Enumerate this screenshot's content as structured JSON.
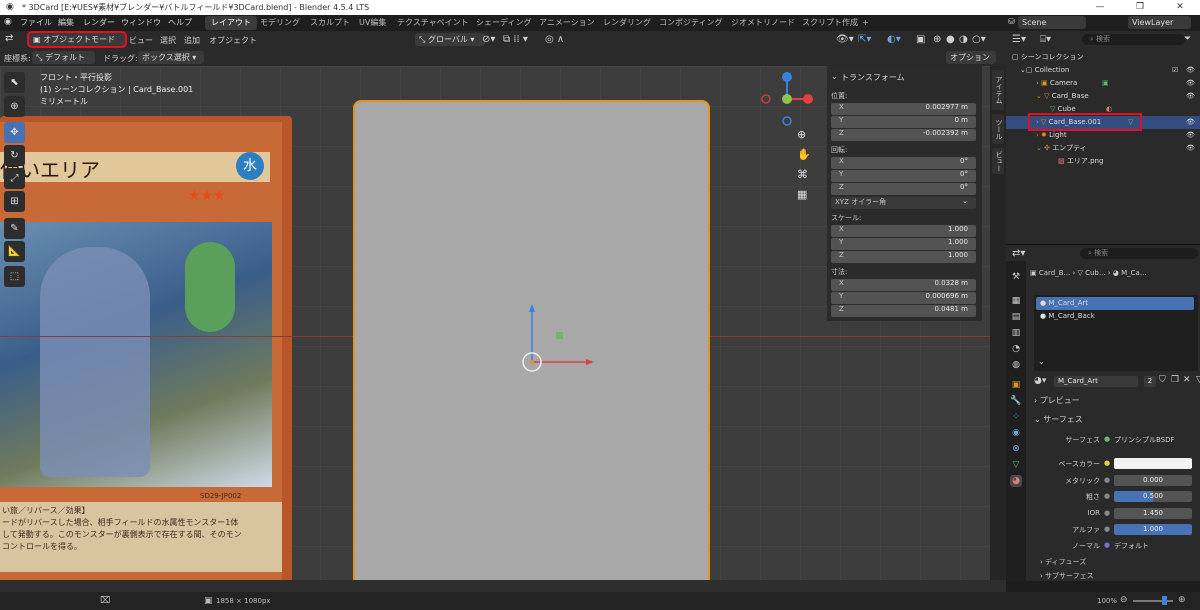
{
  "window": {
    "title": "* 3DCard [E:¥UES¥素材¥ブレンダー¥バトルフィールド¥3DCard.blend] - Blender 4.5.4 LTS",
    "min": "—",
    "max": "❐",
    "close": "✕"
  },
  "menu": [
    "ファイル",
    "編集",
    "レンダー",
    "ウィンドウ",
    "ヘルプ"
  ],
  "tabs": [
    {
      "label": "レイアウト"
    },
    {
      "label": "モデリング"
    },
    {
      "label": "スカルプト"
    },
    {
      "label": "UV編集"
    },
    {
      "label": "テクスチャペイント"
    },
    {
      "label": "シェーディング"
    },
    {
      "label": "アニメーション"
    },
    {
      "label": "レンダリング"
    },
    {
      "label": "コンポジティング"
    },
    {
      "label": "ジオメトリノード"
    },
    {
      "label": "スクリプト作成"
    }
  ],
  "add_tab": "+",
  "scene": "Scene",
  "viewlayer": "ViewLayer",
  "header": {
    "mode": "オブジェクトモード",
    "view": "ビュー",
    "select": "選択",
    "add": "追加",
    "object": "オブジェクト",
    "orientation": "グローバル"
  },
  "header2": {
    "coord_label": "座標系:",
    "coord": "デフォルト",
    "drag_label": "ドラッグ:",
    "drag": "ボックス選択",
    "options": "オプション"
  },
  "overlay": {
    "line1": "フロント・平行投影",
    "line2": "(1) シーンコレクション | Card_Base.001",
    "line3": "ミリメートル"
  },
  "card": {
    "title": "使いエリア",
    "attr": "水",
    "code": "SD29-JP002",
    "text1": "い旅／リバース／効果】",
    "text2": "ードがリバースした場合、相手フィールドの水属性モンスター1体",
    "text3": "して発動する。このモンスターが裏側表示で存在する間、そのモン",
    "text4": "コントロールを得る。"
  },
  "transform": {
    "title": "トランスフォーム",
    "location_label": "位置:",
    "location": [
      {
        "axis": "X",
        "value": "0.002977 m"
      },
      {
        "axis": "Y",
        "value": "0 m"
      },
      {
        "axis": "Z",
        "value": "-0.002392 m"
      }
    ],
    "rotation_label": "回転:",
    "rotation": [
      {
        "axis": "X",
        "value": "0°"
      },
      {
        "axis": "Y",
        "value": "0°"
      },
      {
        "axis": "Z",
        "value": "0°"
      }
    ],
    "rotation_mode": "XYZ オイラー角",
    "scale_label": "スケール:",
    "scale": [
      {
        "axis": "X",
        "value": "1.000"
      },
      {
        "axis": "Y",
        "value": "1.000"
      },
      {
        "axis": "Z",
        "value": "1.000"
      }
    ],
    "dim_label": "寸法:",
    "dimensions": [
      {
        "axis": "X",
        "value": "0.0328 m"
      },
      {
        "axis": "Y",
        "value": "0.000696 m"
      },
      {
        "axis": "Z",
        "value": "0.0481 m"
      }
    ]
  },
  "sidetabs": [
    "アイテム",
    "ツール",
    "ビュー"
  ],
  "outliner": {
    "search": "検索",
    "rows": [
      {
        "label": "シーンコレクション"
      },
      {
        "label": "Collection"
      },
      {
        "label": "Camera"
      },
      {
        "label": "Card_Base"
      },
      {
        "label": "Cube"
      },
      {
        "label": "Card_Base.001"
      },
      {
        "label": "Light"
      },
      {
        "label": "エンプティ"
      },
      {
        "label": "エリア.png"
      }
    ]
  },
  "props": {
    "search": "検索",
    "breadcrumb": [
      "Card_B...",
      "Cub...",
      "M_Ca..."
    ],
    "slots": [
      "M_Card_Art",
      "M_Card_Back"
    ],
    "material": "M_Card_Art",
    "users": "2",
    "preview": "プレビュー",
    "surface_panel": "サーフェス",
    "surface_label": "サーフェス",
    "surface": "プリンシプルBSDF",
    "basecolor": "ベースカラー",
    "metallic_label": "メタリック",
    "metallic": "0.000",
    "rough_label": "粗さ",
    "rough": "0.500",
    "ior_label": "IOR",
    "ior": "1.450",
    "alpha_label": "アルファ",
    "alpha": "1.000",
    "normal_label": "ノーマル",
    "normal": "デフォルト",
    "diffuse": "ディフューズ",
    "subsurface": "サブサーフェス"
  },
  "status": {
    "resolution": "1858 × 1080px",
    "zoom": "100%"
  },
  "colors": {
    "accent": "#4772b3",
    "selection_outline": "#e5931f",
    "highlight_box": "#e3101f"
  }
}
